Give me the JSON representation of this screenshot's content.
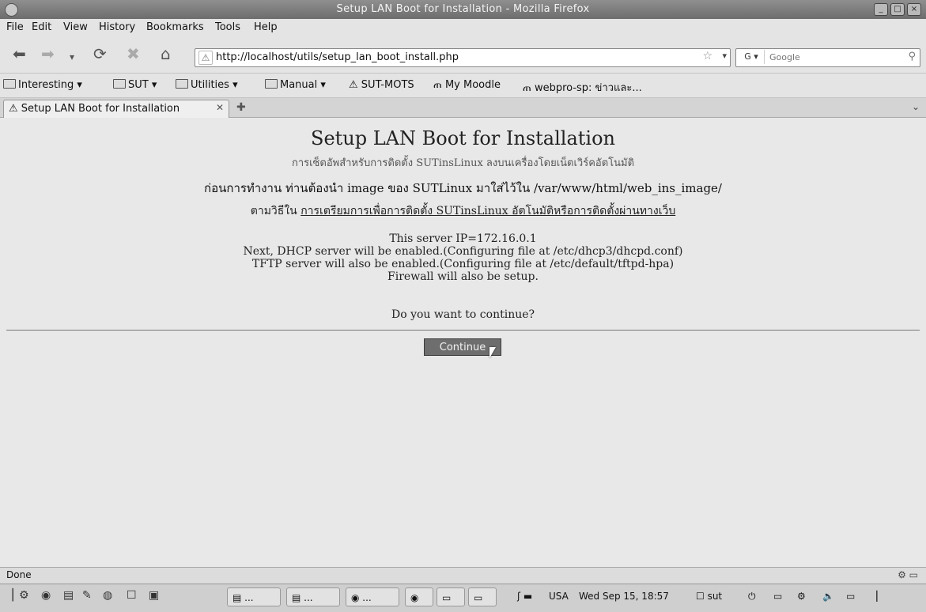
{
  "window": {
    "title": "Setup LAN Boot for Installation - Mozilla Firefox"
  },
  "menu": [
    "File",
    "Edit",
    "View",
    "History",
    "Bookmarks",
    "Tools",
    "Help"
  ],
  "nav": {
    "url": "http://localhost/utils/setup_lan_boot_install.php",
    "search_placeholder": "Google"
  },
  "bookmarks": [
    "Interesting",
    "SUT",
    "Utilities",
    "Manual",
    "SUT-MOTS",
    "My Moodle",
    "webpro-sp: ข่าวและ..."
  ],
  "tab": {
    "label": "Setup LAN Boot for Installation"
  },
  "page": {
    "heading": "Setup LAN Boot for Installation",
    "thai_line1": "การเซ็ตอัพสำหรับการติดตั้ง SUTinsLinux ลงบนเครื่องโดยเน็ตเวิร์คอัตโนมัติ",
    "thai_line2": "ก่อนการทำงาน ท่านต้องนำ image ของ SUTLinux มาใส่ไว้ใน /var/www/html/web_ins_image/",
    "thai_line3_prefix": "ตามวิธีใน",
    "thai_line3_link": "การเตรียมการเพื่อการติดตั้ง SUTinsLinux อัตโนมัติหรือการติดตั้งผ่านทางเว็บ",
    "info_lines": [
      "This server IP=172.16.0.1",
      "Next, DHCP server will be enabled.(Configuring file at /etc/dhcp3/dhcpd.conf)",
      "TFTP server will also be enabled.(Configuring file at /etc/default/tftpd-hpa)",
      "Firewall will also be setup."
    ],
    "question": "Do you want to continue?",
    "button": "Continue"
  },
  "status": {
    "text": "Done"
  },
  "taskbar": {
    "tasks": [
      "...",
      "...",
      "...",
      "...",
      "..."
    ],
    "keyboard": "USA",
    "clock": "Wed Sep 15, 18:57",
    "user": "sut"
  }
}
